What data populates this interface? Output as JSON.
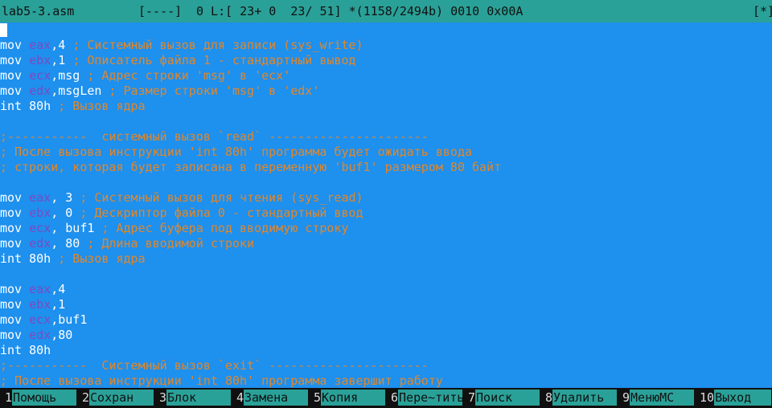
{
  "status": {
    "filename": "lab5-3.asm",
    "flags": "[----]",
    "position": "0 L:[ 23+ 0  23/ 51] *(1158/2494b) 0010 0x00A",
    "marker": "[*]"
  },
  "lines": [
    [],
    [
      {
        "t": "mov ",
        "c": "kw"
      },
      {
        "t": "eax",
        "c": "reg"
      },
      {
        "t": ",4 ",
        "c": "txt"
      },
      {
        "t": "; Системный вызов для записи (sys_write)",
        "c": "cm"
      }
    ],
    [
      {
        "t": "mov ",
        "c": "kw"
      },
      {
        "t": "ebx",
        "c": "reg"
      },
      {
        "t": ",1 ",
        "c": "txt"
      },
      {
        "t": "; Описатель файла 1 - стандартный вывод",
        "c": "cm"
      }
    ],
    [
      {
        "t": "mov ",
        "c": "kw"
      },
      {
        "t": "ecx",
        "c": "reg"
      },
      {
        "t": ",msg ",
        "c": "txt"
      },
      {
        "t": "; Адрес строки 'msg' в 'ecx'",
        "c": "cm"
      }
    ],
    [
      {
        "t": "mov ",
        "c": "kw"
      },
      {
        "t": "edx",
        "c": "reg"
      },
      {
        "t": ",msgLen ",
        "c": "txt"
      },
      {
        "t": "; Размер строки 'msg' в 'edx'",
        "c": "cm"
      }
    ],
    [
      {
        "t": "int 80h ",
        "c": "kw"
      },
      {
        "t": "; Вызов ядра",
        "c": "cm"
      }
    ],
    [],
    [
      {
        "t": ";-----------  системный вызов `read` ----------------------",
        "c": "cm"
      }
    ],
    [
      {
        "t": "; После вызова инструкции 'int 80h' программа будет ожидать ввода",
        "c": "cm"
      }
    ],
    [
      {
        "t": "; строки, которая будет записана в переменную 'buf1' размером 80 байт",
        "c": "cm"
      }
    ],
    [],
    [
      {
        "t": "mov ",
        "c": "kw"
      },
      {
        "t": "eax",
        "c": "reg"
      },
      {
        "t": ", 3 ",
        "c": "txt"
      },
      {
        "t": "; Системный вызов для чтения (sys_read)",
        "c": "cm"
      }
    ],
    [
      {
        "t": "mov ",
        "c": "kw"
      },
      {
        "t": "ebx",
        "c": "reg"
      },
      {
        "t": ", 0 ",
        "c": "txt"
      },
      {
        "t": "; Дескриптор файла 0 - стандартный ввод",
        "c": "cm"
      }
    ],
    [
      {
        "t": "mov ",
        "c": "kw"
      },
      {
        "t": "ecx",
        "c": "reg"
      },
      {
        "t": ", buf1 ",
        "c": "txt"
      },
      {
        "t": "; Адрес буфера под вводимую строку",
        "c": "cm"
      }
    ],
    [
      {
        "t": "mov ",
        "c": "kw"
      },
      {
        "t": "edx",
        "c": "reg"
      },
      {
        "t": ", 80 ",
        "c": "txt"
      },
      {
        "t": "; Длина вводимой строки",
        "c": "cm"
      }
    ],
    [
      {
        "t": "int 80h ",
        "c": "kw"
      },
      {
        "t": "; Вызов ядра",
        "c": "cm"
      }
    ],
    [],
    [
      {
        "t": "mov ",
        "c": "kw"
      },
      {
        "t": "eax",
        "c": "reg"
      },
      {
        "t": ",4",
        "c": "txt"
      }
    ],
    [
      {
        "t": "mov ",
        "c": "kw"
      },
      {
        "t": "ebx",
        "c": "reg"
      },
      {
        "t": ",1",
        "c": "txt"
      }
    ],
    [
      {
        "t": "mov ",
        "c": "kw"
      },
      {
        "t": "ecx",
        "c": "reg"
      },
      {
        "t": ",buf1",
        "c": "txt"
      }
    ],
    [
      {
        "t": "mov ",
        "c": "kw"
      },
      {
        "t": "edx",
        "c": "reg"
      },
      {
        "t": ",80",
        "c": "txt"
      }
    ],
    [
      {
        "t": "int 80h",
        "c": "kw"
      }
    ],
    [
      {
        "t": ";-----------  Системный вызов `exit` ----------------------",
        "c": "cm"
      }
    ],
    [
      {
        "t": "; После вызова инструкции 'int 80h' программа завершит работу",
        "c": "cm"
      }
    ]
  ],
  "cursor_line": 0,
  "fkeys": [
    {
      "num": "1",
      "label": "Помощь"
    },
    {
      "num": "2",
      "label": "Сохран"
    },
    {
      "num": "3",
      "label": "Блок"
    },
    {
      "num": "4",
      "label": "Замена"
    },
    {
      "num": "5",
      "label": "Копия"
    },
    {
      "num": "6",
      "label": "Пере~тить"
    },
    {
      "num": "7",
      "label": "Поиск"
    },
    {
      "num": "8",
      "label": "Удалить"
    },
    {
      "num": "9",
      "label": "МенюMC"
    },
    {
      "num": "10",
      "label": "Выход"
    }
  ],
  "colors": {
    "background": "#1e90ee",
    "status_bar": "#2aa198",
    "keyword": "#ffffff",
    "register": "#7a4bc0",
    "comment": "#e0872b"
  }
}
